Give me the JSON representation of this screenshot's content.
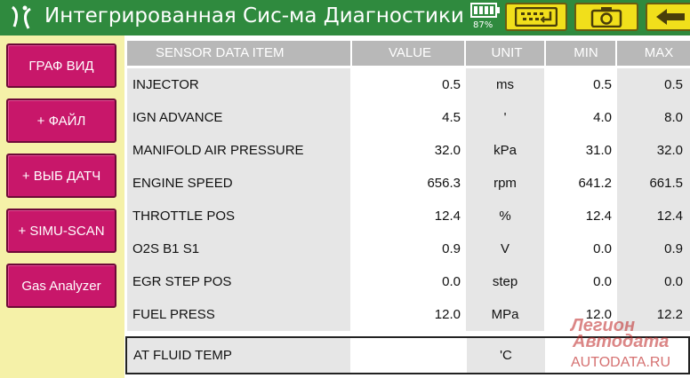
{
  "header": {
    "title": "Интегрированная Сис-ма Диагностики",
    "battery_percent": "87%",
    "buttons": [
      {
        "name": "keyboard-button",
        "icon": "keyboard-icon"
      },
      {
        "name": "camera-button",
        "icon": "camera-icon"
      },
      {
        "name": "back-button",
        "icon": "back-arrow-icon"
      }
    ]
  },
  "sidebar": {
    "items": [
      {
        "label": "ГРАФ ВИД"
      },
      {
        "label": "+ ФАЙЛ"
      },
      {
        "label": "+ ВЫБ ДАТЧ"
      },
      {
        "label": "+ SIMU-SCAN"
      },
      {
        "label": "Gas Analyzer"
      }
    ]
  },
  "table": {
    "columns": {
      "item": "SENSOR DATA ITEM",
      "value": "VALUE",
      "unit": "UNIT",
      "min": "MIN",
      "max": "MAX"
    },
    "rows": [
      {
        "item": "INJECTOR",
        "value": "0.5",
        "unit": "ms",
        "min": "0.5",
        "max": "0.5"
      },
      {
        "item": "IGN ADVANCE",
        "value": "4.5",
        "unit": "'",
        "min": "4.0",
        "max": "8.0"
      },
      {
        "item": "MANIFOLD AIR PRESSURE",
        "value": "32.0",
        "unit": "kPa",
        "min": "31.0",
        "max": "32.0"
      },
      {
        "item": "ENGINE SPEED",
        "value": "656.3",
        "unit": "rpm",
        "min": "641.2",
        "max": "661.5"
      },
      {
        "item": "THROTTLE POS",
        "value": "12.4",
        "unit": "%",
        "min": "12.4",
        "max": "12.4"
      },
      {
        "item": "O2S B1 S1",
        "value": "0.9",
        "unit": "V",
        "min": "0.0",
        "max": "0.9"
      },
      {
        "item": "EGR STEP POS",
        "value": "0.0",
        "unit": "step",
        "min": "0.0",
        "max": "0.0"
      },
      {
        "item": "FUEL PRESS",
        "value": "12.0",
        "unit": "MPa",
        "min": "12.0",
        "max": "12.2"
      }
    ],
    "selected_row": {
      "item": "AT FLUID TEMP",
      "value": "",
      "unit": "'C",
      "min": "",
      "max": ""
    }
  },
  "watermark": {
    "line1": "Легион",
    "line2": "Автодата",
    "line3": "AUTODATA.RU"
  },
  "colors": {
    "header": "#2f8a3e",
    "sidebar_button": "#c8176a",
    "header_button": "#f1df1b",
    "background": "#f5f1a8"
  }
}
